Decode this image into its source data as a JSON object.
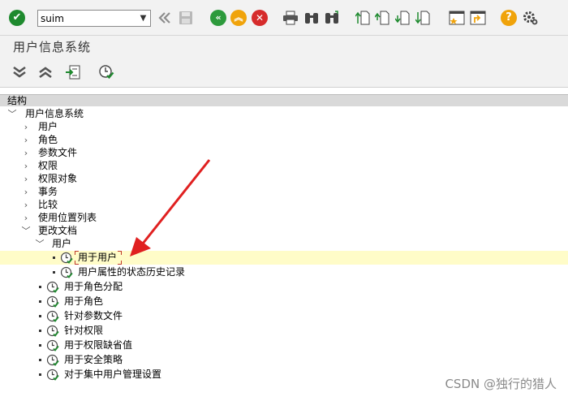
{
  "toolbar": {
    "command_value": "suim"
  },
  "title": "用户信息系统",
  "tree": {
    "header": "结构",
    "root": "用户信息系统",
    "items": [
      "用户",
      "角色",
      "参数文件",
      "权限",
      "权限对象",
      "事务",
      "比较",
      "使用位置列表",
      "更改文档"
    ],
    "change_docs": {
      "user_folder": "用户",
      "user_children": [
        "用于用户",
        "用户属性的状态历史记录"
      ],
      "others": [
        "用于角色分配",
        "用于角色",
        "针对参数文件",
        "针对权限",
        "用于权限缺省值",
        "用于安全策略",
        "对于集中用户管理设置"
      ]
    }
  },
  "watermark": "CSDN @独行的猎人",
  "colors": {
    "enter_green": "#1e8a2e",
    "back_green": "#2d9a3c",
    "exit_orange": "#f0a30a",
    "cancel_red": "#d62b2b",
    "help_orange": "#f0a30a",
    "highlight_row": "#fffcc8",
    "annotation_red": "#e02020"
  }
}
